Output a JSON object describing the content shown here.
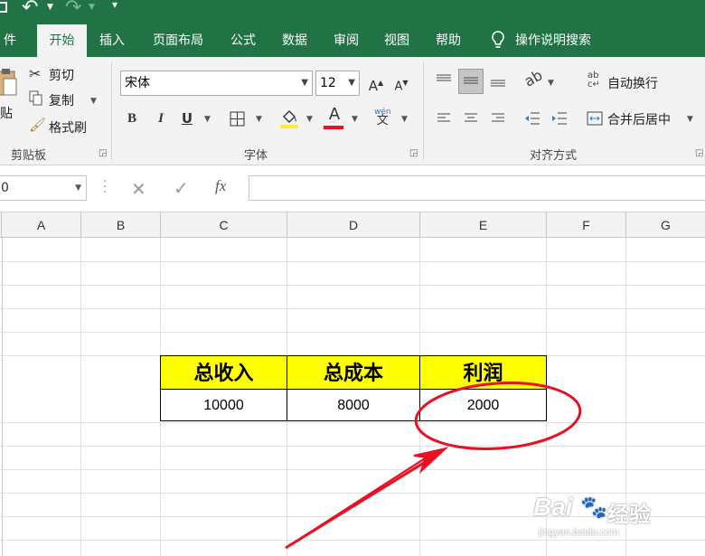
{
  "ribbon_tabs": [
    {
      "label": "件"
    },
    {
      "label": "开始"
    },
    {
      "label": "插入"
    },
    {
      "label": "页面布局"
    },
    {
      "label": "公式"
    },
    {
      "label": "数据"
    },
    {
      "label": "审阅"
    },
    {
      "label": "视图"
    },
    {
      "label": "帮助"
    },
    {
      "label": "操作说明搜索"
    }
  ],
  "clipboard": {
    "paste": "贴",
    "cut": "剪切",
    "copy": "复制",
    "format_painter": "格式刷",
    "group_label": "剪贴板"
  },
  "font": {
    "name": "宋体",
    "size": "12",
    "bold": "B",
    "italic": "I",
    "underline": "U",
    "font_color_glyph": "A",
    "phonetic_glyph": "wén",
    "group_label": "字体",
    "fill_color": "#ffeb3b",
    "text_color": "#e81123"
  },
  "alignment": {
    "wrap_text": "自动换行",
    "merge_center": "合并后居中",
    "group_label": "对齐方式"
  },
  "formula_bar": {
    "name_box": "0",
    "fx": "fx",
    "formula": ""
  },
  "columns": [
    "A",
    "B",
    "C",
    "D",
    "E",
    "F",
    "G"
  ],
  "table": {
    "headers": [
      "总收入",
      "总成本",
      "利润"
    ],
    "values": [
      "10000",
      "8000",
      "2000"
    ],
    "header_fill": "#ffff00"
  },
  "annotation": {
    "color": "#e81123"
  },
  "watermark": {
    "brand": "Bai",
    "suffix": "经验",
    "url": "jingyan.baidu.com"
  }
}
